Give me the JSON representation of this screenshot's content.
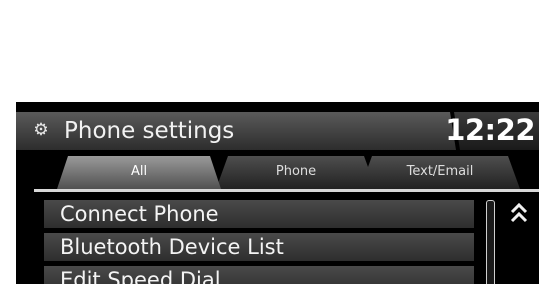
{
  "header": {
    "title": "Phone settings",
    "clock": "12:22",
    "icon": "gear-icon"
  },
  "tabs": [
    {
      "label": "All",
      "selected": true
    },
    {
      "label": "Phone",
      "selected": false
    },
    {
      "label": "Text/Email",
      "selected": false
    }
  ],
  "menu": {
    "items": [
      {
        "label": "Connect Phone"
      },
      {
        "label": "Bluetooth Device List"
      },
      {
        "label": "Edit Speed Dial"
      }
    ]
  },
  "scroll": {
    "up_icon": "double-chevron-up-icon"
  },
  "colors": {
    "background": "#000000",
    "text": "#f2f2f2"
  }
}
